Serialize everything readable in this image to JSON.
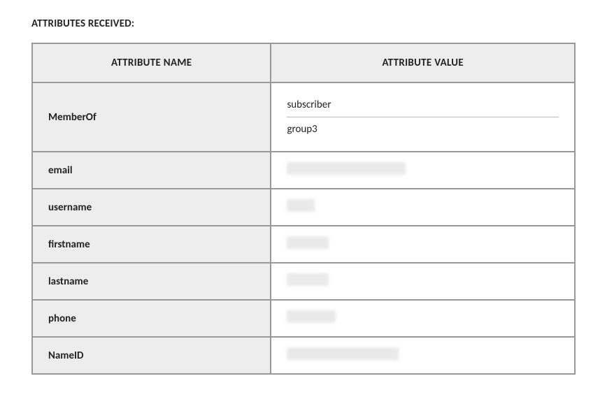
{
  "title": "ATTRIBUTES RECEIVED:",
  "headers": {
    "name": "ATTRIBUTE NAME",
    "value": "ATTRIBUTE VALUE"
  },
  "rows": [
    {
      "name": "MemberOf",
      "values": [
        "subscriber",
        "group3"
      ],
      "redacted": false
    },
    {
      "name": "email",
      "redacted": true,
      "redactClass": "r1"
    },
    {
      "name": "username",
      "redacted": true,
      "redactClass": "r2"
    },
    {
      "name": "firstname",
      "redacted": true,
      "redactClass": "r3"
    },
    {
      "name": "lastname",
      "redacted": true,
      "redactClass": "r4"
    },
    {
      "name": "phone",
      "redacted": true,
      "redactClass": "r5"
    },
    {
      "name": "NameID",
      "redacted": true,
      "redactClass": "r6"
    }
  ]
}
